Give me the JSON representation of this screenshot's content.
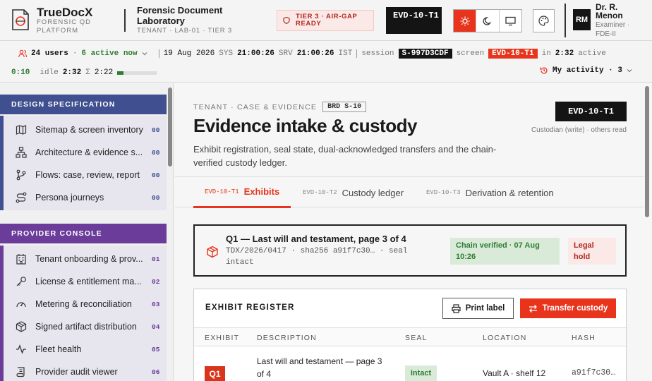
{
  "header": {
    "brand_name": "TrueDocX",
    "brand_sub": "Forensic QD Platform",
    "lab_title": "Forensic Document Laboratory",
    "lab_sub": "Tenant · LAB-01 · Tier 3",
    "tier_badge": "TIER 3 · AIR-GAP READY",
    "screen_id": "EVD-10-T1",
    "theme_options": [
      "sun-icon",
      "moon-icon",
      "monitor-icon"
    ],
    "active_theme": "light",
    "avatar_initials": "RM",
    "user_name": "Dr. R. Menon",
    "user_role": "Examiner · FDE-II"
  },
  "status": {
    "users": "24 users",
    "active": "6 active now",
    "date": "19 Aug 2026",
    "sys_label": "SYS",
    "sys_time": "21:00:26",
    "srv_label": "SRV",
    "srv_time": "21:00:26",
    "tz": "IST",
    "session_label": "session",
    "session_id": "S-997D3CDF",
    "screen_label": "screen",
    "screen_id": "EVD-10-T1",
    "in_label": "in",
    "in_time": "2:32",
    "active_label": "active",
    "active_time": "0:10",
    "idle_label": "idle",
    "idle_time": "2:32",
    "sigma_label": "Σ",
    "sigma_time": "2:22",
    "idle_progress": 0.15,
    "my_activity": "My activity · 3"
  },
  "sidebar": {
    "sections": [
      {
        "title": "Design specification",
        "color": "#3f4f8f",
        "items": [
          {
            "label": "Sitemap & screen inventory",
            "num": "00",
            "icon": "map-icon"
          },
          {
            "label": "Architecture & evidence s...",
            "num": "00",
            "icon": "architecture-icon"
          },
          {
            "label": "Flows: case, review, report",
            "num": "00",
            "icon": "flow-icon"
          },
          {
            "label": "Persona journeys",
            "num": "00",
            "icon": "journey-icon"
          }
        ]
      },
      {
        "title": "Provider console",
        "color": "#6b3c9a",
        "items": [
          {
            "label": "Tenant onboarding & prov...",
            "num": "01",
            "icon": "building-icon"
          },
          {
            "label": "License & entitlement ma...",
            "num": "02",
            "icon": "key-icon"
          },
          {
            "label": "Metering & reconciliation",
            "num": "03",
            "icon": "gauge-icon"
          },
          {
            "label": "Signed artifact distribution",
            "num": "04",
            "icon": "package-icon"
          },
          {
            "label": "Fleet health",
            "num": "05",
            "icon": "pulse-icon"
          },
          {
            "label": "Provider audit viewer",
            "num": "06",
            "icon": "scroll-icon"
          }
        ]
      }
    ]
  },
  "main": {
    "crumb": "Tenant · Case & evidence",
    "brd": "BRD S-10",
    "title": "Evidence intake & custody",
    "description": "Exhibit registration, seal state, dual-acknowledged transfers and the chain-verified custody ledger.",
    "screen_chip": "EVD-10-T1",
    "custodian": "Custodian (write) · others read",
    "tabs": [
      {
        "code": "EVD-10-T1",
        "label": "Exhibits"
      },
      {
        "code": "EVD-10-T2",
        "label": "Custody ledger"
      },
      {
        "code": "EVD-10-T3",
        "label": "Derivation & retention"
      }
    ],
    "exhibit": {
      "title": "Q1 — Last will and testament, page 3 of 4",
      "meta": "TDX/2026/0417 · sha256 a91f7c30… · seal intact",
      "chain": "Chain verified · 07 Aug 10:26",
      "hold": "Legal hold"
    },
    "register": {
      "title": "Exhibit register",
      "print_label": "Print label",
      "transfer_label": "Transfer custody",
      "columns": [
        "Exhibit",
        "Description",
        "Seal",
        "Location",
        "Hash"
      ],
      "rows": [
        {
          "exhibit": "Q1",
          "description": "Last will and testament — page 3 of 4",
          "seal": "Intact",
          "location": "Vault A · shelf 12",
          "hash": "a91f7c30…"
        }
      ]
    }
  }
}
